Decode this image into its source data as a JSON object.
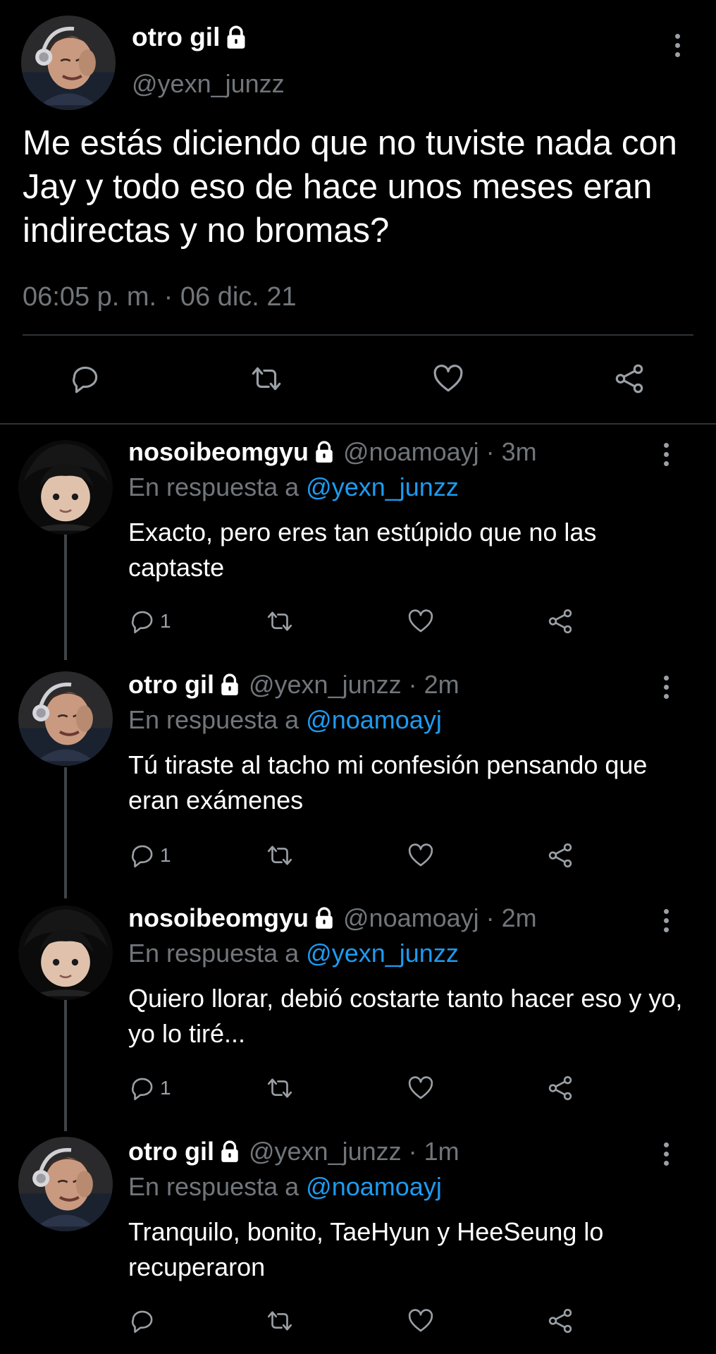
{
  "main_tweet": {
    "display_name": "otro gil",
    "handle": "@yexn_junzz",
    "text": "Me estás diciendo que no tuviste nada con Jay y todo eso de hace unos meses eran indirectas y no bromas?",
    "timestamp": "06:05 p. m. · 06 dic. 21"
  },
  "replies": [
    {
      "display_name": "nosoibeomgyu",
      "meta": "@noamoayj · 3m",
      "reply_prefix": "En respuesta a",
      "reply_to": "@yexn_junzz",
      "text": "Exacto, pero eres tan estúpido que no las captaste",
      "reply_count": "1"
    },
    {
      "display_name": "otro gil",
      "meta": "@yexn_junzz · 2m",
      "reply_prefix": "En respuesta a",
      "reply_to": "@noamoayj",
      "text": "Tú tiraste al tacho mi confesión pensando que eran exámenes",
      "reply_count": "1"
    },
    {
      "display_name": "nosoibeomgyu",
      "meta": "@noamoayj · 2m",
      "reply_prefix": "En respuesta a",
      "reply_to": "@yexn_junzz",
      "text": "Quiero llorar, debió costarte tanto hacer eso y yo, yo lo tiré...",
      "reply_count": "1"
    },
    {
      "display_name": "otro gil",
      "meta": "@yexn_junzz · 1m",
      "reply_prefix": "En respuesta a",
      "reply_to": "@noamoayj",
      "text": "Tranquilo, bonito, TaeHyun y HeeSeung lo recuperaron",
      "reply_count": ""
    }
  ],
  "icons": {
    "reply": "reply-icon",
    "retweet": "retweet-icon",
    "like": "heart-icon",
    "share": "share-icon",
    "more": "more-dots-icon",
    "lock": "lock-icon"
  },
  "colors": {
    "background": "#000000",
    "muted_text": "#71767b",
    "mention": "#1d9bf0",
    "divider": "#2f3336"
  }
}
